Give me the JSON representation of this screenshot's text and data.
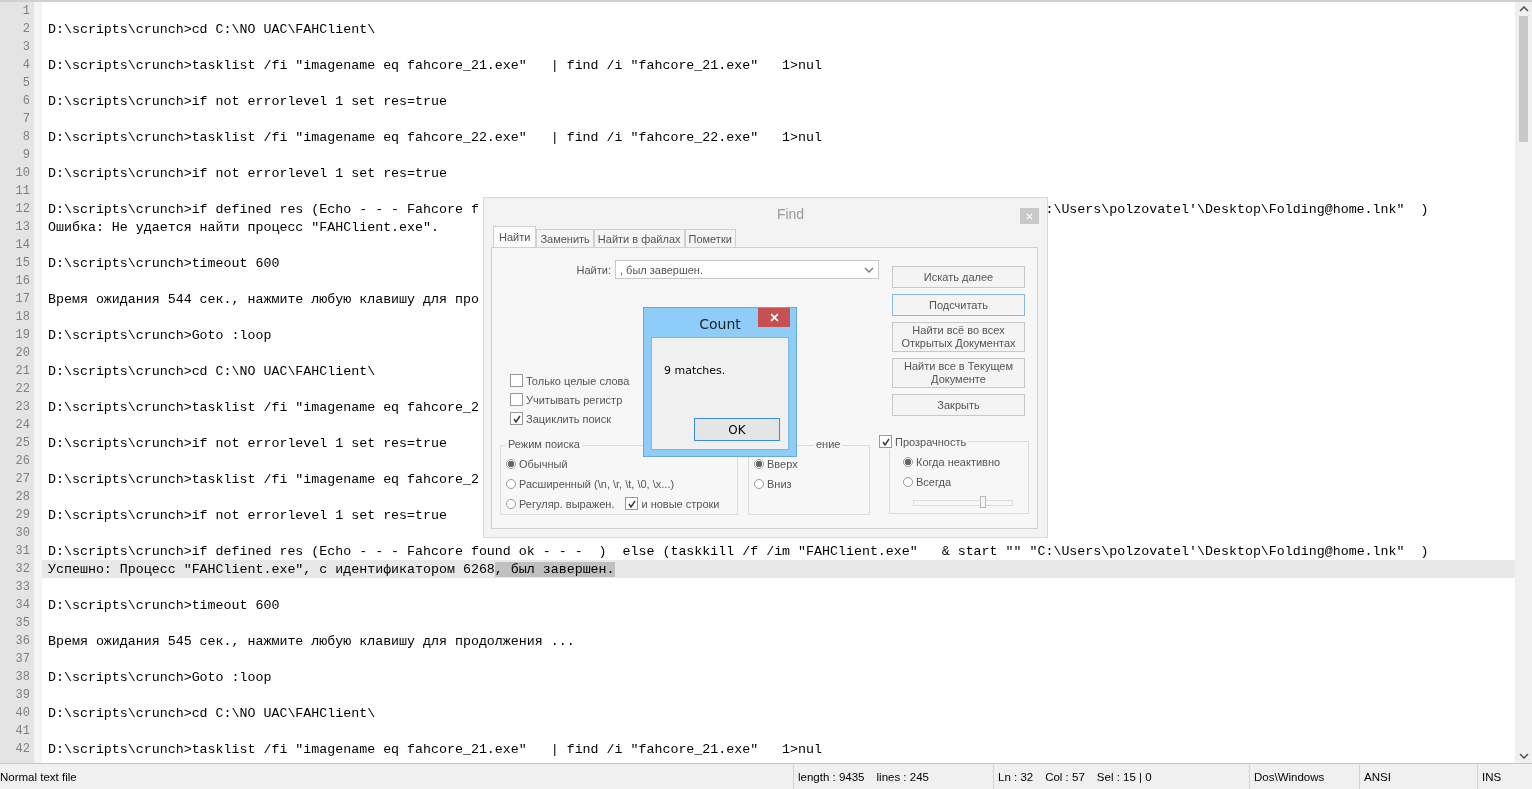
{
  "editor": {
    "lines": [
      {
        "number": "1",
        "current": false
      },
      {
        "number": "2",
        "text": "D:\\scripts\\crunch>cd C:\\NO UAC\\FAHClient\\",
        "current": false
      },
      {
        "number": "3",
        "current": false
      },
      {
        "number": "4",
        "text": "D:\\scripts\\crunch>tasklist /fi \"imagename eq fahcore_21.exe\"   | find /i \"fahcore_21.exe\"   1>nul",
        "current": false
      },
      {
        "number": "5",
        "current": false
      },
      {
        "number": "6",
        "text": "D:\\scripts\\crunch>if not errorlevel 1 set res=true",
        "current": false
      },
      {
        "number": "7",
        "current": false
      },
      {
        "number": "8",
        "text": "D:\\scripts\\crunch>tasklist /fi \"imagename eq fahcore_22.exe\"   | find /i \"fahcore_22.exe\"   1>nul",
        "current": false
      },
      {
        "number": "9",
        "current": false
      },
      {
        "number": "10",
        "text": "D:\\scripts\\crunch>if not errorlevel 1 set res=true",
        "current": false
      },
      {
        "number": "11",
        "current": false
      },
      {
        "number": "12",
        "text": "D:\\scripts\\crunch>if defined res (Echo - - - Fahcore f",
        "text_after_dialog": ":\\Users\\polzovatel'\\Desktop\\Folding@home.lnk\"  )",
        "current": false
      },
      {
        "number": "13",
        "text": "Ошибка: Не удается найти процесс \"FAHClient.exe\".",
        "current": false
      },
      {
        "number": "14",
        "current": false
      },
      {
        "number": "15",
        "text": "D:\\scripts\\crunch>timeout 600",
        "current": false
      },
      {
        "number": "16",
        "current": false
      },
      {
        "number": "17",
        "text": "Время ожидания 544 сек., нажмите любую клавишу для про",
        "current": false
      },
      {
        "number": "18",
        "current": false
      },
      {
        "number": "19",
        "text": "D:\\scripts\\crunch>Goto :loop",
        "current": false
      },
      {
        "number": "20",
        "current": false
      },
      {
        "number": "21",
        "text": "D:\\scripts\\crunch>cd C:\\NO UAC\\FAHClient\\",
        "current": false
      },
      {
        "number": "22",
        "current": false
      },
      {
        "number": "23",
        "text": "D:\\scripts\\crunch>tasklist /fi \"imagename eq fahcore_2",
        "current": false
      },
      {
        "number": "24",
        "current": false
      },
      {
        "number": "25",
        "text": "D:\\scripts\\crunch>if not errorlevel 1 set res=true",
        "current": false
      },
      {
        "number": "26",
        "current": false
      },
      {
        "number": "27",
        "text": "D:\\scripts\\crunch>tasklist /fi \"imagename eq fahcore_2",
        "current": false
      },
      {
        "number": "28",
        "current": false
      },
      {
        "number": "29",
        "text": "D:\\scripts\\crunch>if not errorlevel 1 set res=true",
        "current": false
      },
      {
        "number": "30",
        "current": false
      },
      {
        "number": "31",
        "text": "D:\\scripts\\crunch>if defined res (Echo - - - Fahcore found ok - - -  )  else (taskkill /f /im \"FAHClient.exe\"   & start \"\" \"C:\\Users\\polzovatel'\\Desktop\\Folding@home.lnk\"  )",
        "current": false
      },
      {
        "number": "32",
        "text": "Успешно: Процесс \"FAHClient.exe\", с идентификатором 6268",
        "selection": ", был завершен.",
        "current": true
      },
      {
        "number": "33",
        "current": false
      },
      {
        "number": "34",
        "text": "D:\\scripts\\crunch>timeout 600",
        "current": false
      },
      {
        "number": "35",
        "current": false
      },
      {
        "number": "36",
        "text": "Время ожидания 545 сек., нажмите любую клавишу для продолжения ...",
        "current": false
      },
      {
        "number": "37",
        "current": false
      },
      {
        "number": "38",
        "text": "D:\\scripts\\crunch>Goto :loop",
        "current": false
      },
      {
        "number": "39",
        "current": false
      },
      {
        "number": "40",
        "text": "D:\\scripts\\crunch>cd C:\\NO UAC\\FAHClient\\",
        "current": false
      },
      {
        "number": "41",
        "current": false
      },
      {
        "number": "42",
        "text": "D:\\scripts\\crunch>tasklist /fi \"imagename eq fahcore_21.exe\"   | find /i \"fahcore_21.exe\"   1>nul",
        "current": false
      }
    ]
  },
  "find_dialog": {
    "title": "Find",
    "tabs": [
      {
        "label": "Найти",
        "selected": true
      },
      {
        "label": "Заменить",
        "selected": false
      },
      {
        "label": "Найти в файлах",
        "selected": false
      },
      {
        "label": "Пометки",
        "selected": false
      }
    ],
    "find_label": "Найти:",
    "find_value": ", был завершен.",
    "buttons": [
      {
        "label": "Искать далее",
        "focused": false
      },
      {
        "label": "Подсчитать",
        "focused": true
      },
      {
        "label": "Найти всё во всех Открытых Документах",
        "focused": false
      },
      {
        "label": "Найти все в Текущем Документе",
        "focused": false
      },
      {
        "label": "Закрыть",
        "focused": false
      }
    ],
    "options": [
      {
        "label": "Только целые слова",
        "checked": false
      },
      {
        "label": "Учитывать регистр",
        "checked": false
      },
      {
        "label": "Зациклить поиск",
        "checked": true
      }
    ],
    "search_mode": {
      "title": "Режим поиска",
      "options": [
        {
          "label": "Обычный",
          "selected": true
        },
        {
          "label": "Расширенный (\\n, \\r, \\t, \\0, \\x...)",
          "selected": false
        },
        {
          "label": "Регуляр. выражен.",
          "selected": false
        }
      ],
      "newlines": {
        "label": "и новые строки",
        "checked": true
      }
    },
    "direction": {
      "title": "ение",
      "options": [
        {
          "label": "Вверх",
          "selected": true
        },
        {
          "label": "Вниз",
          "selected": false
        }
      ]
    },
    "transparency": {
      "label": "Прозрачность",
      "checked": true,
      "options": [
        {
          "label": "Когда неактивно",
          "selected": true
        },
        {
          "label": "Всегда",
          "selected": false
        }
      ],
      "level": 0.7
    }
  },
  "count_dialog": {
    "title": "Count",
    "message": "9 matches.",
    "button": "OK"
  },
  "status_bar": {
    "file_type": "Normal text file",
    "length": "length : 9435",
    "lines": "lines : 245",
    "ln": "Ln : 32",
    "col": "Col : 57",
    "sel": "Sel : 15 | 0",
    "eol": "Dos\\Windows",
    "encoding": "ANSI",
    "mode": "INS"
  }
}
